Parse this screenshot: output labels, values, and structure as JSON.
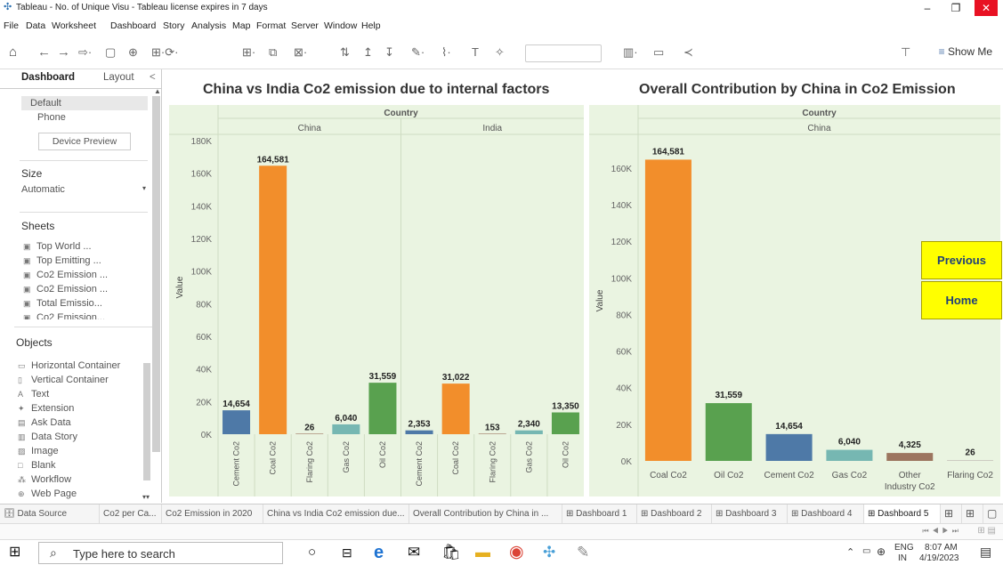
{
  "window": {
    "title": "Tableau - No. of Unique Visu - Tableau license expires in 7 days",
    "minimize": "–",
    "maximize": "❐",
    "close": "✕"
  },
  "menu": [
    "File",
    "Data",
    "Worksheet",
    "Dashboard",
    "Story",
    "Analysis",
    "Map",
    "Format",
    "Server",
    "Window",
    "Help"
  ],
  "toolbar": {
    "show_me": "Show Me"
  },
  "left_panel": {
    "tabs": {
      "dashboard": "Dashboard",
      "layout": "Layout",
      "collapse": "<"
    },
    "devices": {
      "default": "Default",
      "phone": "Phone",
      "device_preview": "Device Preview"
    },
    "size": {
      "heading": "Size",
      "value": "Automatic"
    },
    "sheets": {
      "heading": "Sheets",
      "items": [
        "Top World ...",
        "Top Emitting ...",
        "Co2 Emission ...",
        "Co2 Emission ...",
        "Total Emissio...",
        "Co2 Emission..."
      ]
    },
    "objects": {
      "heading": "Objects",
      "items": [
        "Horizontal Container",
        "Vertical Container",
        "Text",
        "Extension",
        "Ask Data",
        "Data Story",
        "Image",
        "Blank",
        "Workflow",
        "Web Page"
      ]
    }
  },
  "chart_left_title": "China vs India Co2 emission due to internal factors",
  "chart_right_title": "Overall Contribution by China in Co2 Emission",
  "buttons": {
    "previous": "Previous",
    "home": "Home"
  },
  "chart_data": [
    {
      "type": "bar",
      "title": "China vs India Co2 emission due to internal factors",
      "header": "Country",
      "ylabel": "Value",
      "ylim": [
        0,
        180000
      ],
      "yticks": [
        "0K",
        "20K",
        "40K",
        "60K",
        "80K",
        "100K",
        "120K",
        "140K",
        "160K",
        "180K"
      ],
      "colors": {
        "Cement Co2": "#4e79a7",
        "Coal Co2": "#f28e2b",
        "Flaring Co2": "#9c755f",
        "Gas Co2": "#76b7b2",
        "Oil Co2": "#59a14f"
      },
      "panes": [
        {
          "name": "China",
          "categories": [
            "Cement Co2",
            "Coal Co2",
            "Flaring Co2",
            "Gas Co2",
            "Oil Co2"
          ],
          "values": [
            14654,
            164581,
            26,
            6040,
            31559
          ],
          "labels": [
            "14,654",
            "164,581",
            "26",
            "6,040",
            "31,559"
          ]
        },
        {
          "name": "India",
          "categories": [
            "Cement Co2",
            "Coal Co2",
            "Flaring Co2",
            "Gas Co2",
            "Oil Co2"
          ],
          "values": [
            2353,
            31022,
            153,
            2340,
            13350
          ],
          "labels": [
            "2,353",
            "31,022",
            "153",
            "2,340",
            "13,350"
          ]
        }
      ]
    },
    {
      "type": "bar",
      "title": "Overall Contribution by China in Co2 Emission",
      "header": "Country",
      "pane": "China",
      "ylabel": "Value",
      "ylim": [
        0,
        175000
      ],
      "yticks": [
        "0K",
        "20K",
        "40K",
        "60K",
        "80K",
        "100K",
        "120K",
        "140K",
        "160K"
      ],
      "categories": [
        "Coal Co2",
        "Oil Co2",
        "Cement Co2",
        "Gas Co2",
        "Other Industry Co2",
        "Flaring Co2"
      ],
      "category_lines": [
        [
          "Coal Co2"
        ],
        [
          "Oil Co2"
        ],
        [
          "Cement Co2"
        ],
        [
          "Gas Co2"
        ],
        [
          "Other",
          "Industry Co2"
        ],
        [
          "Flaring Co2"
        ]
      ],
      "values": [
        164581,
        31559,
        14654,
        6040,
        4325,
        26
      ],
      "labels": [
        "164,581",
        "31,559",
        "14,654",
        "6,040",
        "4,325",
        "26"
      ],
      "colors": [
        "#f28e2b",
        "#59a14f",
        "#4e79a7",
        "#76b7b2",
        "#9c755f",
        "#bab0ac"
      ]
    }
  ],
  "sheet_tabs": [
    "Data Source",
    "Co2 per Ca...",
    "Co2 Emission in 2020",
    "China vs India Co2 emission due...",
    "Overall Contribution by China in ...",
    "Dashboard 1",
    "Dashboard 2",
    "Dashboard 3",
    "Dashboard 4",
    "Dashboard 5"
  ],
  "taskbar": {
    "search_placeholder": "Type here to search",
    "lang": "ENG",
    "region": "IN",
    "time": "8:07 AM",
    "date": "4/19/2023"
  }
}
